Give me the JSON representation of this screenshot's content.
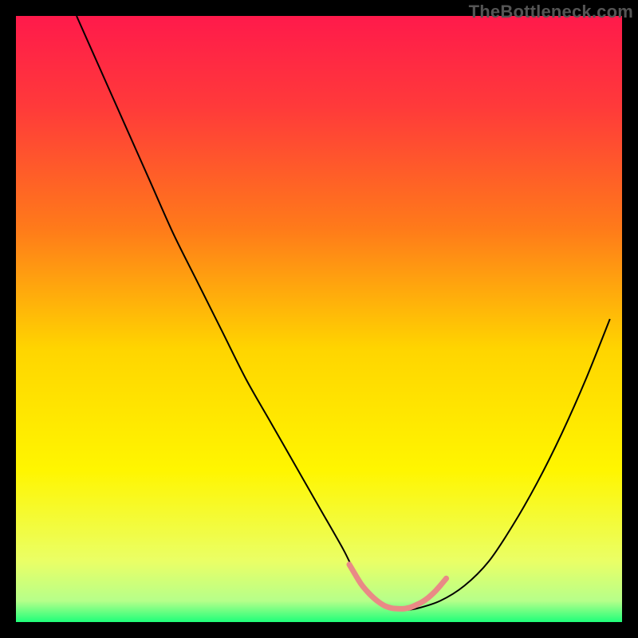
{
  "watermark": "TheBottleneck.com",
  "chart_data": {
    "type": "line",
    "title": "",
    "xlabel": "",
    "ylabel": "",
    "xlim": [
      0,
      100
    ],
    "ylim": [
      0,
      100
    ],
    "background_gradient": {
      "stops": [
        {
          "offset": 0.0,
          "color": "#ff1a4b"
        },
        {
          "offset": 0.15,
          "color": "#ff3a3a"
        },
        {
          "offset": 0.35,
          "color": "#ff7a1a"
        },
        {
          "offset": 0.55,
          "color": "#ffd500"
        },
        {
          "offset": 0.75,
          "color": "#fff600"
        },
        {
          "offset": 0.9,
          "color": "#eaff66"
        },
        {
          "offset": 0.965,
          "color": "#b6ff8a"
        },
        {
          "offset": 1.0,
          "color": "#1fff7a"
        }
      ]
    },
    "series": [
      {
        "name": "bottleneck-curve",
        "stroke": "#000000",
        "stroke_width": 2,
        "x": [
          10,
          14,
          18,
          22,
          26,
          30,
          34,
          38,
          42,
          46,
          50,
          54,
          56,
          58,
          60,
          62,
          64,
          66,
          70,
          74,
          78,
          82,
          86,
          90,
          94,
          98
        ],
        "y": [
          100,
          91,
          82,
          73,
          64,
          56,
          48,
          40,
          33,
          26,
          19,
          12,
          8,
          5,
          3,
          2.2,
          2,
          2.2,
          3.5,
          6,
          10,
          16,
          23,
          31,
          40,
          50
        ]
      },
      {
        "name": "sweet-spot-marker",
        "stroke": "#e98a86",
        "stroke_width": 7,
        "linecap": "round",
        "x": [
          55,
          56,
          57,
          58,
          59,
          60,
          61,
          62,
          63,
          64,
          65,
          66,
          67,
          68,
          69,
          70,
          71
        ],
        "y": [
          9.5,
          7.8,
          6.2,
          5.0,
          4.0,
          3.2,
          2.6,
          2.3,
          2.2,
          2.2,
          2.4,
          2.8,
          3.3,
          4.0,
          4.9,
          6.0,
          7.2
        ]
      }
    ]
  }
}
